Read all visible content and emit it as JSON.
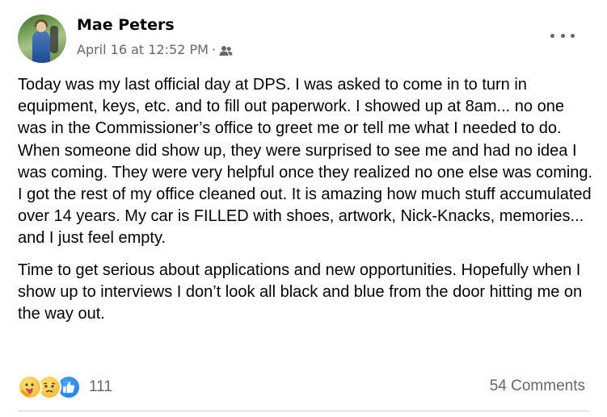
{
  "post": {
    "author": "Mae Peters",
    "date": "April 16 at 12:52 PM",
    "separator": "·",
    "audience_icon": "friends-icon",
    "more_icon": "more-options-icon",
    "paragraphs": [
      "Today was my last official day at DPS. I was asked to come in to turn in equipment, keys, etc. and to fill out paperwork. I showed up at 8am... no one was in the Commissioner’s office to greet me or tell me what I needed to do. When someone did show up, they were surprised to see me and had no idea I was coming. They were very helpful once they realized no one else was coming. I got the rest of my office cleaned out. It is amazing how much stuff accumulated over 14 years. My car is FILLED with shoes, artwork, Nick-Knacks, memories... and I just feel empty.",
      "Time to get serious about applications and new opportunities. Hopefully when I show up to interviews I don’t look all black and blue from the door hitting me on the way out."
    ],
    "reactions": {
      "icons": [
        "care-reaction-icon",
        "sad-reaction-icon",
        "like-reaction-icon"
      ],
      "count": "111"
    },
    "comments_label": "54 Comments"
  },
  "colors": {
    "text_primary": "#050505",
    "text_secondary": "#65676b",
    "like_blue": "#1877f2",
    "reaction_yellow": "#f7b125",
    "divider": "#ced0d4"
  }
}
